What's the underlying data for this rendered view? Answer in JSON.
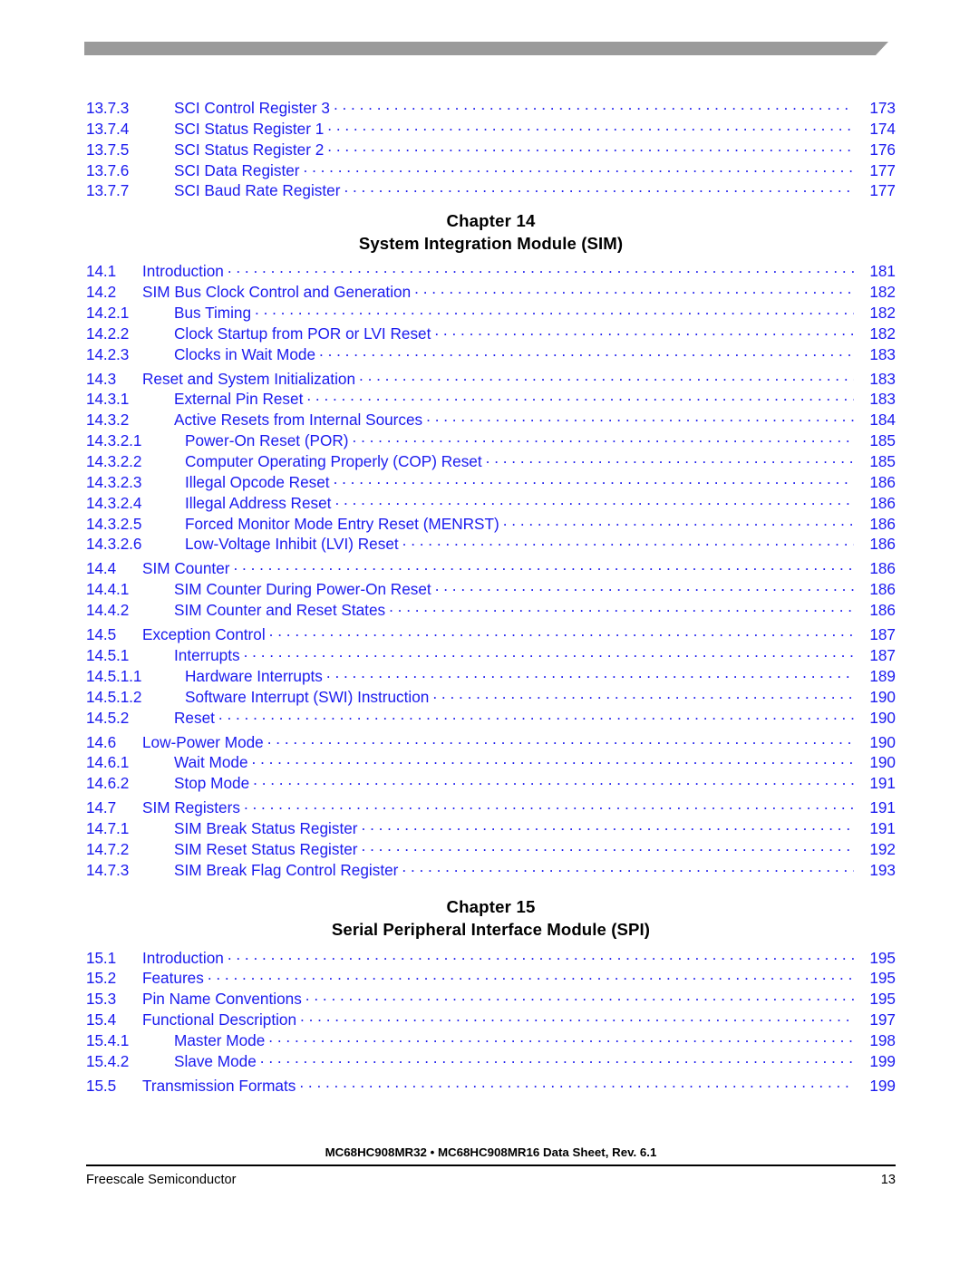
{
  "document": {
    "footer_title": "MC68HC908MR32 • MC68HC908MR16 Data Sheet, Rev. 6.1",
    "footer_left": "Freescale Semiconductor",
    "footer_page": "13"
  },
  "colors": {
    "entry_blue": "#1b1bef",
    "heading_black": "#000000",
    "banner_gray": "#9a9a9a"
  },
  "toc": {
    "continued_entries": [
      {
        "number": "13.7.3",
        "title": "SCI Control Register 3",
        "page": "173",
        "level": 3
      },
      {
        "number": "13.7.4",
        "title": "SCI Status Register 1",
        "page": "174",
        "level": 3
      },
      {
        "number": "13.7.5",
        "title": "SCI Status Register 2",
        "page": "176",
        "level": 3
      },
      {
        "number": "13.7.6",
        "title": "SCI Data Register",
        "page": "177",
        "level": 3
      },
      {
        "number": "13.7.7",
        "title": "SCI Baud Rate Register",
        "page": "177",
        "level": 3
      }
    ],
    "chapters": [
      {
        "label": "Chapter 14",
        "title": "System Integration Module (SIM)",
        "entries": [
          {
            "number": "14.1",
            "title": "Introduction",
            "page": "181",
            "level": 2,
            "gap": false
          },
          {
            "number": "14.2",
            "title": "SIM Bus Clock Control and Generation",
            "page": "182",
            "level": 2,
            "gap": false
          },
          {
            "number": "14.2.1",
            "title": "Bus Timing",
            "page": "182",
            "level": 3,
            "gap": false
          },
          {
            "number": "14.2.2",
            "title": "Clock Startup from POR or LVI Reset",
            "page": "182",
            "level": 3,
            "gap": false
          },
          {
            "number": "14.2.3",
            "title": "Clocks in Wait Mode",
            "page": "183",
            "level": 3,
            "gap": false
          },
          {
            "number": "14.3",
            "title": "Reset and System Initialization",
            "page": "183",
            "level": 2,
            "gap": true
          },
          {
            "number": "14.3.1",
            "title": "External Pin Reset",
            "page": "183",
            "level": 3,
            "gap": false
          },
          {
            "number": "14.3.2",
            "title": "Active Resets from Internal Sources",
            "page": "184",
            "level": 3,
            "gap": false
          },
          {
            "number": "14.3.2.1",
            "title": "Power-On Reset (POR)",
            "page": "185",
            "level": 4,
            "gap": false
          },
          {
            "number": "14.3.2.2",
            "title": "Computer Operating Properly (COP) Reset",
            "page": "185",
            "level": 4,
            "gap": false
          },
          {
            "number": "14.3.2.3",
            "title": "Illegal Opcode Reset",
            "page": "186",
            "level": 4,
            "gap": false
          },
          {
            "number": "14.3.2.4",
            "title": "Illegal Address Reset",
            "page": "186",
            "level": 4,
            "gap": false
          },
          {
            "number": "14.3.2.5",
            "title": "Forced Monitor Mode Entry Reset (MENRST)",
            "page": "186",
            "level": 4,
            "gap": false
          },
          {
            "number": "14.3.2.6",
            "title": "Low-Voltage Inhibit (LVI) Reset",
            "page": "186",
            "level": 4,
            "gap": false
          },
          {
            "number": "14.4",
            "title": "SIM Counter",
            "page": "186",
            "level": 2,
            "gap": true
          },
          {
            "number": "14.4.1",
            "title": "SIM Counter During Power-On Reset",
            "page": "186",
            "level": 3,
            "gap": false
          },
          {
            "number": "14.4.2",
            "title": "SIM Counter and Reset States",
            "page": "186",
            "level": 3,
            "gap": false
          },
          {
            "number": "14.5",
            "title": "Exception Control",
            "page": "187",
            "level": 2,
            "gap": true
          },
          {
            "number": "14.5.1",
            "title": "Interrupts",
            "page": "187",
            "level": 3,
            "gap": false
          },
          {
            "number": "14.5.1.1",
            "title": "Hardware Interrupts",
            "page": "189",
            "level": 4,
            "gap": false
          },
          {
            "number": "14.5.1.2",
            "title": "Software Interrupt (SWI) Instruction",
            "page": "190",
            "level": 4,
            "gap": false
          },
          {
            "number": "14.5.2",
            "title": "Reset",
            "page": "190",
            "level": 3,
            "gap": false
          },
          {
            "number": "14.6",
            "title": "Low-Power Mode",
            "page": "190",
            "level": 2,
            "gap": true
          },
          {
            "number": "14.6.1",
            "title": "Wait Mode",
            "page": "190",
            "level": 3,
            "gap": false
          },
          {
            "number": "14.6.2",
            "title": "Stop Mode",
            "page": "191",
            "level": 3,
            "gap": false
          },
          {
            "number": "14.7",
            "title": "SIM Registers",
            "page": "191",
            "level": 2,
            "gap": true
          },
          {
            "number": "14.7.1",
            "title": "SIM Break Status Register",
            "page": "191",
            "level": 3,
            "gap": false
          },
          {
            "number": "14.7.2",
            "title": "SIM Reset Status Register",
            "page": "192",
            "level": 3,
            "gap": false
          },
          {
            "number": "14.7.3",
            "title": "SIM Break Flag Control Register",
            "page": "193",
            "level": 3,
            "gap": false
          }
        ]
      },
      {
        "label": "Chapter 15",
        "title": "Serial Peripheral Interface Module (SPI)",
        "entries": [
          {
            "number": "15.1",
            "title": "Introduction",
            "page": "195",
            "level": 2,
            "gap": false
          },
          {
            "number": "15.2",
            "title": "Features",
            "page": "195",
            "level": 2,
            "gap": false
          },
          {
            "number": "15.3",
            "title": "Pin Name Conventions",
            "page": "195",
            "level": 2,
            "gap": false
          },
          {
            "number": "15.4",
            "title": "Functional Description",
            "page": "197",
            "level": 2,
            "gap": false
          },
          {
            "number": "15.4.1",
            "title": "Master Mode",
            "page": "198",
            "level": 3,
            "gap": false
          },
          {
            "number": "15.4.2",
            "title": "Slave Mode",
            "page": "199",
            "level": 3,
            "gap": false
          },
          {
            "number": "15.5",
            "title": "Transmission Formats",
            "page": "199",
            "level": 2,
            "gap": true
          }
        ]
      }
    ]
  }
}
